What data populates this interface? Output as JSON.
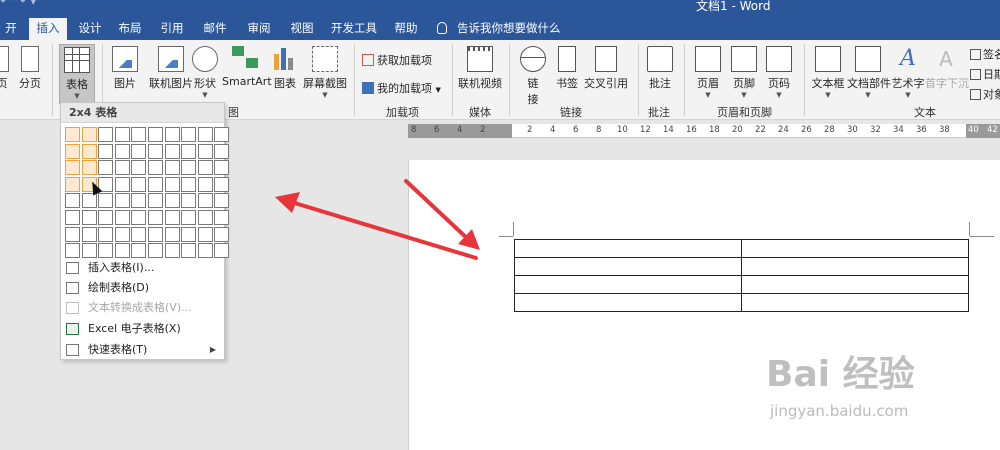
{
  "window": {
    "title": "文档1 - Word"
  },
  "tabs": [
    {
      "label": "开始"
    },
    {
      "label": "插入"
    },
    {
      "label": "设计"
    },
    {
      "label": "布局"
    },
    {
      "label": "引用"
    },
    {
      "label": "邮件"
    },
    {
      "label": "审阅"
    },
    {
      "label": "视图"
    },
    {
      "label": "开发工具"
    },
    {
      "label": "帮助"
    }
  ],
  "active_tab": "插入",
  "tell_me": "告诉我你想要做什么",
  "ribbon": {
    "pages": {
      "page_label": "页",
      "break_label": "分页"
    },
    "tables": {
      "table_label": "表格"
    },
    "illustrations": {
      "pictures": "图片",
      "online_pictures": "联机图片",
      "shapes": "形状",
      "smartart": "SmartArt",
      "chart": "图表",
      "screenshot": "屏幕截图",
      "group_label": "图"
    },
    "addins": {
      "get": "获取加载项",
      "my": "我的加载项",
      "group_label": "加载项"
    },
    "media": {
      "online_video": "联机视频",
      "group_label": "媒体"
    },
    "links": {
      "link": "链\n接",
      "link_top": "链",
      "link_bottom": "接",
      "bookmark": "书签",
      "cross_ref": "交叉引用",
      "group_label": "链接"
    },
    "comments": {
      "comment": "批注",
      "group_label": "批注"
    },
    "header_footer": {
      "header": "页眉",
      "footer": "页脚",
      "page_number": "页码",
      "group_label": "页眉和页脚"
    },
    "text": {
      "textbox": "文本框",
      "quick_parts": "文档部件",
      "wordart": "艺术字",
      "dropcap": "首字下沉",
      "signature": "签名",
      "date": "日期",
      "object": "对象",
      "group_label": "文本"
    }
  },
  "ruler": {
    "labels": [
      "8",
      "6",
      "4",
      "2",
      "2",
      "4",
      "6",
      "8",
      "10",
      "12",
      "14",
      "16",
      "18",
      "20",
      "22",
      "24",
      "26",
      "28",
      "30",
      "32",
      "34",
      "36",
      "38",
      "40",
      "42"
    ]
  },
  "dropdown": {
    "grid_label": "2x4 表格",
    "grid_cols": 10,
    "grid_rows": 8,
    "selected_cols": 2,
    "selected_rows": 4,
    "items": [
      {
        "label": "插入表格(I)...",
        "disabled": false,
        "submenu": false
      },
      {
        "label": "绘制表格(D)",
        "disabled": false,
        "submenu": false
      },
      {
        "label": "文本转换成表格(V)...",
        "disabled": true,
        "submenu": false
      },
      {
        "label": "Excel 电子表格(X)",
        "disabled": false,
        "submenu": false
      },
      {
        "label": "快速表格(T)",
        "disabled": false,
        "submenu": true
      }
    ]
  },
  "document": {
    "table": {
      "rows": 4,
      "cols": 2
    }
  },
  "colors": {
    "accent": "#2b579a",
    "highlight": "#f0a03c",
    "annotation_arrow": "#e8353a"
  },
  "watermark": {
    "main": "Bai 经验",
    "sub": "jingyan.baidu.com"
  }
}
